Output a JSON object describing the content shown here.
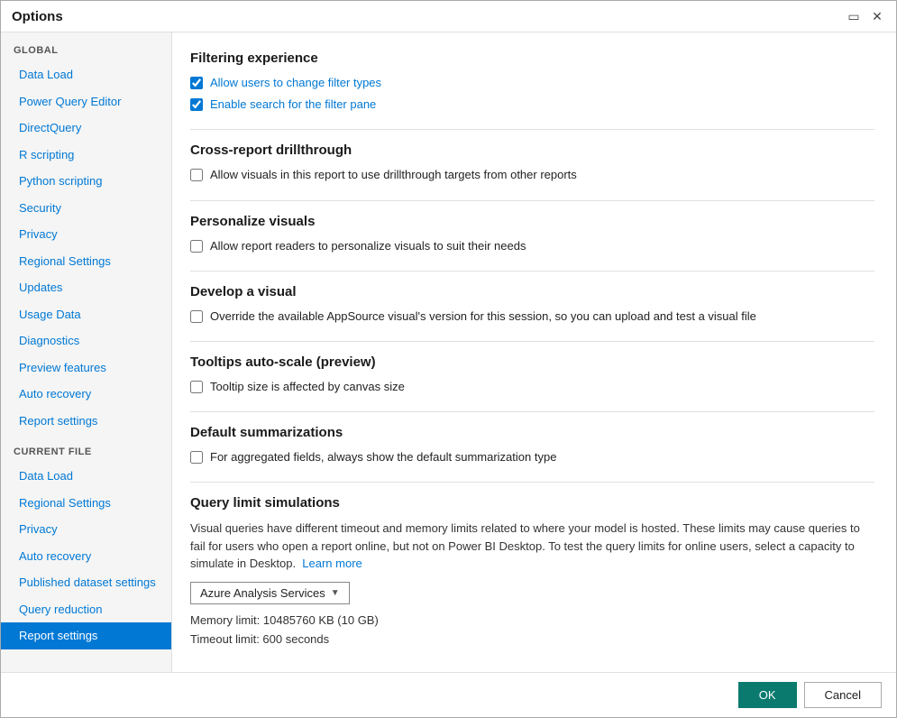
{
  "window": {
    "title": "Options"
  },
  "sidebar": {
    "global_header": "GLOBAL",
    "current_file_header": "CURRENT FILE",
    "global_items": [
      {
        "label": "Data Load",
        "id": "data-load"
      },
      {
        "label": "Power Query Editor",
        "id": "power-query-editor"
      },
      {
        "label": "DirectQuery",
        "id": "directquery"
      },
      {
        "label": "R scripting",
        "id": "r-scripting"
      },
      {
        "label": "Python scripting",
        "id": "python-scripting"
      },
      {
        "label": "Security",
        "id": "security"
      },
      {
        "label": "Privacy",
        "id": "privacy"
      },
      {
        "label": "Regional Settings",
        "id": "regional-settings"
      },
      {
        "label": "Updates",
        "id": "updates"
      },
      {
        "label": "Usage Data",
        "id": "usage-data"
      },
      {
        "label": "Diagnostics",
        "id": "diagnostics"
      },
      {
        "label": "Preview features",
        "id": "preview-features"
      },
      {
        "label": "Auto recovery",
        "id": "auto-recovery"
      },
      {
        "label": "Report settings",
        "id": "report-settings"
      }
    ],
    "current_file_items": [
      {
        "label": "Data Load",
        "id": "cf-data-load"
      },
      {
        "label": "Regional Settings",
        "id": "cf-regional-settings"
      },
      {
        "label": "Privacy",
        "id": "cf-privacy"
      },
      {
        "label": "Auto recovery",
        "id": "cf-auto-recovery"
      },
      {
        "label": "Published dataset settings",
        "id": "cf-published-dataset"
      },
      {
        "label": "Query reduction",
        "id": "cf-query-reduction"
      },
      {
        "label": "Report settings",
        "id": "cf-report-settings",
        "active": true
      }
    ]
  },
  "main": {
    "sections": [
      {
        "id": "filtering-experience",
        "title": "Filtering experience",
        "checkboxes": [
          {
            "id": "allow-filter-types",
            "checked": true,
            "label": "Allow users to change filter types",
            "highlight": true
          },
          {
            "id": "enable-search-filter",
            "checked": true,
            "label": "Enable search for the filter pane",
            "highlight": true
          }
        ]
      },
      {
        "id": "cross-report-drillthrough",
        "title": "Cross-report drillthrough",
        "checkboxes": [
          {
            "id": "allow-visuals-drillthrough",
            "checked": false,
            "label": "Allow visuals in this report to use drillthrough targets from other reports",
            "highlight": false
          }
        ]
      },
      {
        "id": "personalize-visuals",
        "title": "Personalize visuals",
        "checkboxes": [
          {
            "id": "allow-personalize",
            "checked": false,
            "label": "Allow report readers to personalize visuals to suit their needs",
            "highlight": false
          }
        ]
      },
      {
        "id": "develop-visual",
        "title": "Develop a visual",
        "checkboxes": [
          {
            "id": "override-appsource",
            "checked": false,
            "label": "Override the available AppSource visual's version for this session, so you can upload and test a visual file",
            "highlight": false
          }
        ]
      },
      {
        "id": "tooltips-autoscale",
        "title": "Tooltips auto-scale (preview)",
        "checkboxes": [
          {
            "id": "tooltip-canvas-size",
            "checked": false,
            "label": "Tooltip size is affected by canvas size",
            "highlight": false
          }
        ]
      },
      {
        "id": "default-summarizations",
        "title": "Default summarizations",
        "checkboxes": [
          {
            "id": "aggregated-fields",
            "checked": false,
            "label": "For aggregated fields, always show the default summarization type",
            "highlight": false
          }
        ]
      }
    ],
    "query_limit": {
      "title": "Query limit simulations",
      "description": "Visual queries have different timeout and memory limits related to where your model is hosted. These limits may cause queries to fail for users who open a report online, but not on Power BI Desktop. To test the query limits for online users, select a capacity to simulate in Desktop.",
      "learn_more": "Learn more",
      "dropdown_value": "Azure Analysis Services",
      "memory_limit": "Memory limit: 10485760 KB (10 GB)",
      "timeout_limit": "Timeout limit: 600 seconds"
    }
  },
  "footer": {
    "ok_label": "OK",
    "cancel_label": "Cancel"
  },
  "icons": {
    "minimize": "▭",
    "close": "✕",
    "chevron_down": "▾",
    "scroll_up": "▲",
    "scroll_down": "▼"
  }
}
